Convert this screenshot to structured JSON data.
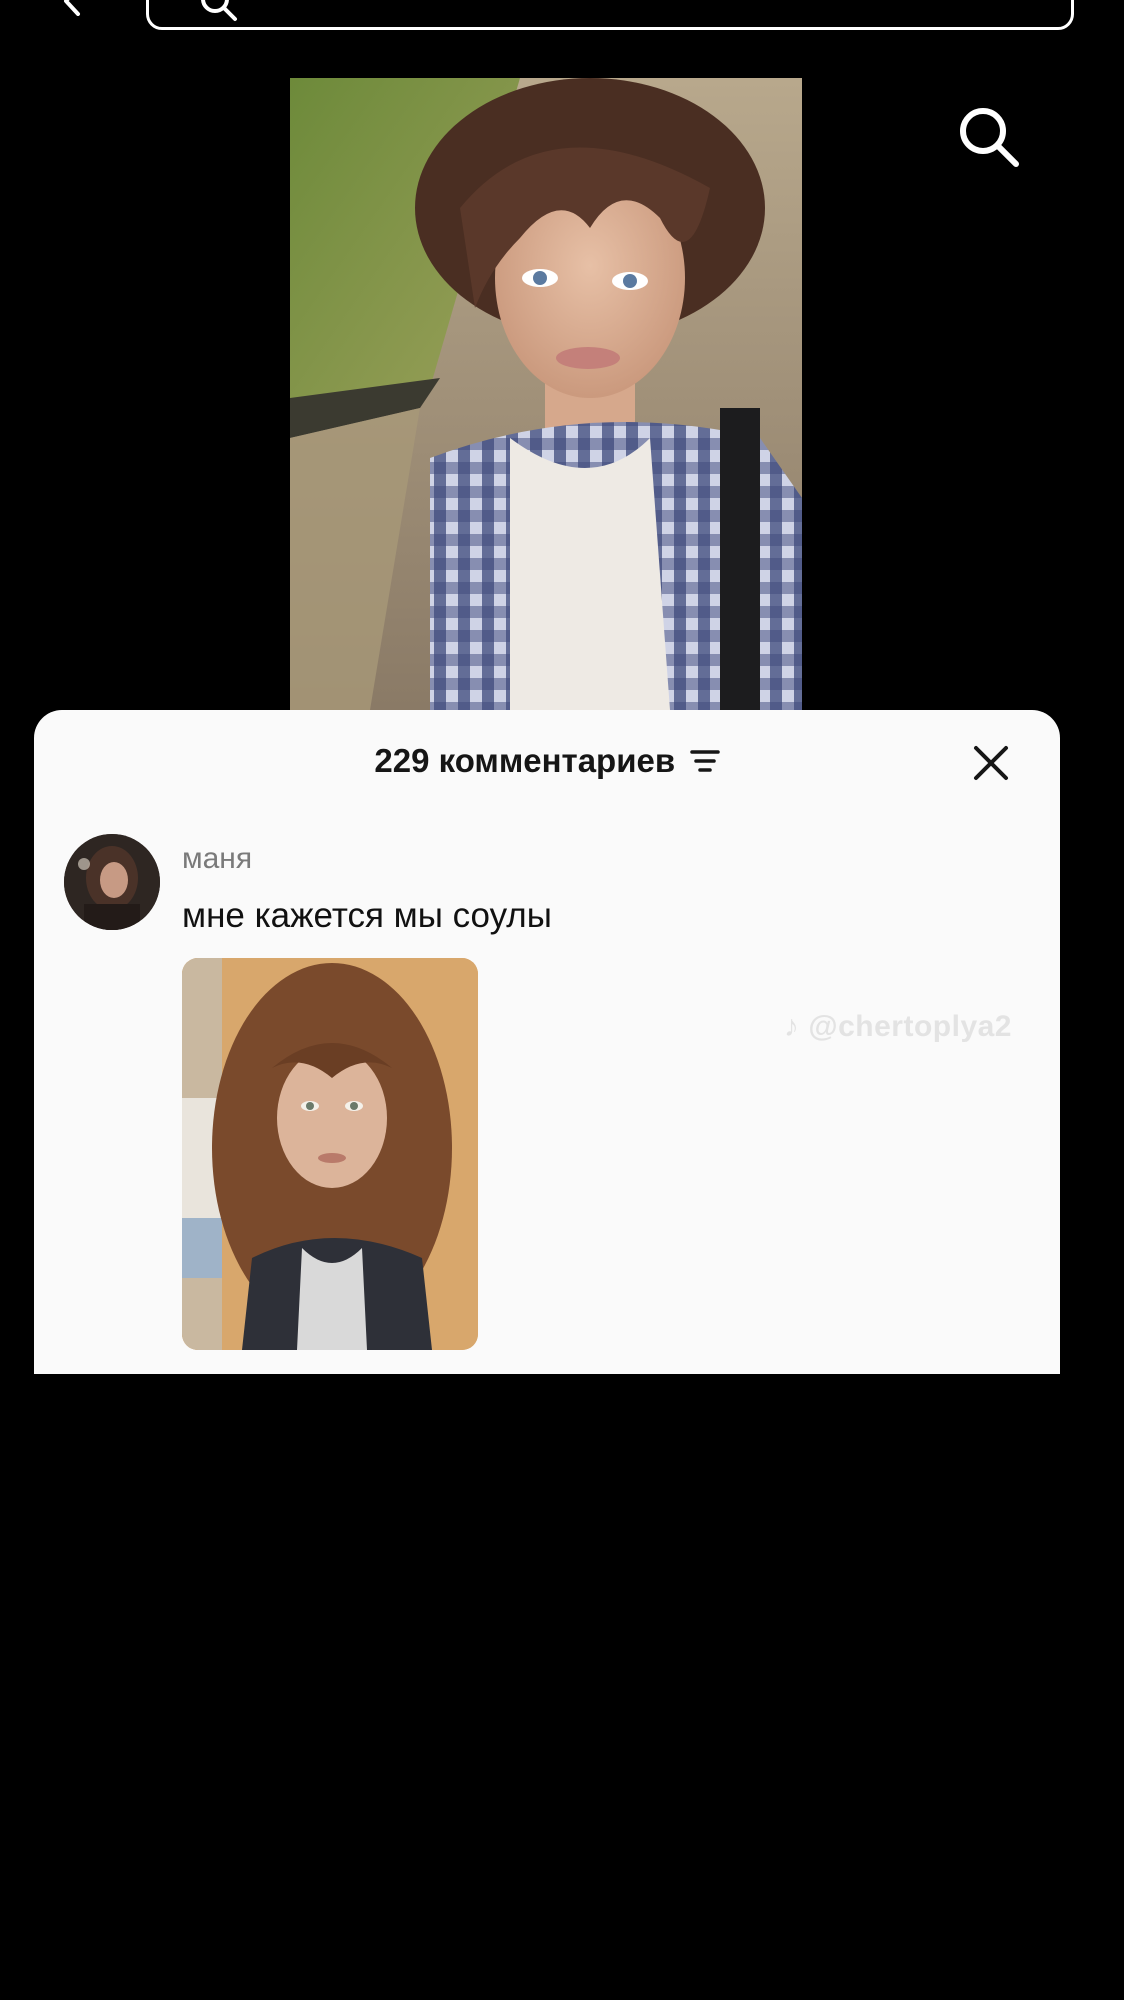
{
  "top_bar": {
    "back_icon": "chevron-left-icon",
    "search_icon": "search-icon"
  },
  "video": {
    "description_icon": "video-frame"
  },
  "search_button": {
    "icon": "search-icon"
  },
  "comments_sheet": {
    "title": "229 комментариев",
    "filter_icon": "sort-filter-icon",
    "close_icon": "close-icon",
    "comments": [
      {
        "username": "маня",
        "text": "мне кажется мы соулы",
        "has_photo": true
      }
    ],
    "watermark": "@chertoplya2"
  },
  "colors": {
    "background": "#000000",
    "sheet": "#fafafa",
    "title": "#161616",
    "username": "#7a7a7a"
  }
}
